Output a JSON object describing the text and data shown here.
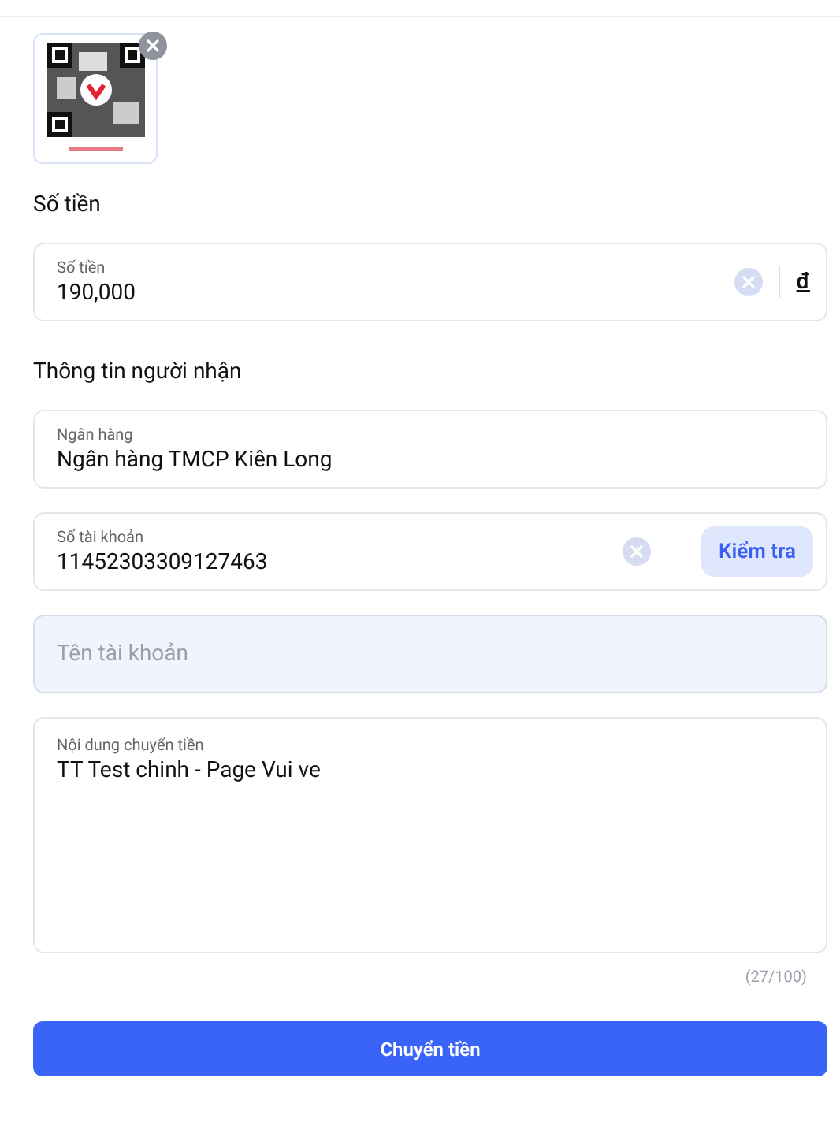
{
  "amount_section": {
    "title": "Số tiền",
    "field": {
      "label": "Số tiền",
      "value": "190,000",
      "currency": "đ"
    }
  },
  "recipient_section": {
    "title": "Thông tin người nhận"
  },
  "bank_field": {
    "label": "Ngân hàng",
    "value": "Ngân hàng TMCP Kiên Long"
  },
  "account_field": {
    "label": "Số tài khoản",
    "value": "11452303309127463",
    "button": "Kiểm tra"
  },
  "account_name_field": {
    "placeholder": "Tên tài khoản",
    "disabled": true
  },
  "message_field": {
    "label": "Nội dung chuyển tiền",
    "value": "TT Test chinh - Page Vui ve",
    "counter": "(27/100)"
  },
  "submit_button": "Chuyển tiền"
}
